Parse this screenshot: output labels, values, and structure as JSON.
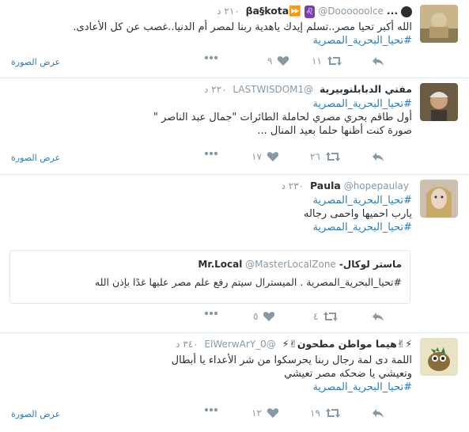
{
  "tweets": [
    {
      "name": "...βa§kota⏩",
      "name_prefix_emoji": "♌",
      "handle": "@Doooooolce",
      "time": "٢١٠ د",
      "lines": [
        "الله أكبر تحيا مصر..تسلم إيدك ياهدية ربنا لمصر أم الدنيا..غصب عن كل الأعادى."
      ],
      "hashtags": [
        "#تحيا_البحرية_المصرية"
      ],
      "retweets": "١١",
      "likes": "٩",
      "view_photo": "عرض الصورة"
    },
    {
      "name": "مفني الدبابلنوبيرية",
      "handle": "@LASTWISDOM1",
      "time": "٢٢٠ د",
      "hashtags_top": [
        "#تحيا_البحرية_المصرية"
      ],
      "lines": [
        "أول طاقم بحري مصري لحاملة الطائرات \"جمال عبد الناصر \"",
        "صورة كنت أظنها حلما بعيد المنال ..."
      ],
      "retweets": "٢٦",
      "likes": "١٧",
      "view_photo": "عرض الصورة"
    },
    {
      "name": "Paula",
      "handle": "@hopepaulay",
      "time": "٢٣٠ د",
      "hashtags_top": [
        "#تحيا_البحرية_المصرية"
      ],
      "lines": [
        "يارب احميها واحمى رجاله"
      ],
      "hashtags": [
        "#تحيا_البحرية_المصرية"
      ],
      "quote": {
        "name": "ماستر لوكال-Mr.Local",
        "handle": "@MasterLocalZone",
        "text": "#تحيا_البحرية_المصرية . الميسترال سيتم رفع علم مصر عليها غدًا بإذن الله"
      },
      "retweets": "٤",
      "likes": "٥"
    },
    {
      "name": "⚡✌هيما مواطن مطحون✌⚡",
      "handle": "@ElWerwArY_0",
      "time": "٣٤٠ د",
      "lines": [
        "اللمة دى لمة رجال ربنا يحرسكوا من شر الأعداء يا أبطال",
        "وتعيشي يا ضحكه مصر تعيشي"
      ],
      "hashtags": [
        "#تحيا_البحرية_المصرية"
      ],
      "retweets": "١٩",
      "likes": "١٢",
      "view_photo": "عرض الصورة"
    }
  ],
  "colors": {
    "link": "#2b7bb9",
    "muted": "#8899a6",
    "text": "#292f33",
    "border": "#e1e8ed"
  }
}
